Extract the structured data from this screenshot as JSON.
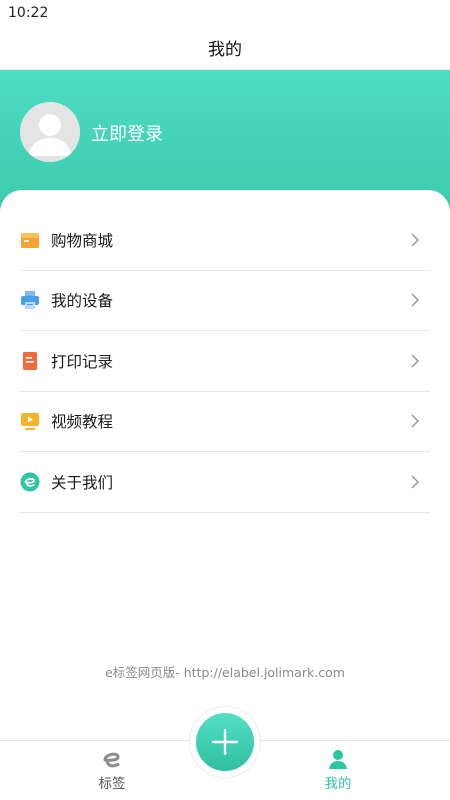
{
  "status_bar": {
    "time": "10:22"
  },
  "title_bar": {
    "title": "我的"
  },
  "profile": {
    "login_label": "立即登录"
  },
  "menu": {
    "items": [
      {
        "label": "购物商城",
        "icon": "shopping-icon",
        "color": "#f7a532"
      },
      {
        "label": "我的设备",
        "icon": "printer-icon",
        "color": "#4a9ee6"
      },
      {
        "label": "打印记录",
        "icon": "document-icon",
        "color": "#f06a3a"
      },
      {
        "label": "视频教程",
        "icon": "video-icon",
        "color": "#f5b52a"
      },
      {
        "label": "关于我们",
        "icon": "e-logo-icon",
        "color": "#2ec5a5"
      }
    ]
  },
  "footer": {
    "website": "e标签网页版- http://elabel.jolimark.com"
  },
  "bottom_nav": {
    "tabs": [
      {
        "label": "标签",
        "icon": "e-label-icon",
        "active": false
      },
      {
        "label": "我的",
        "icon": "person-icon",
        "active": true
      }
    ],
    "center_button": {
      "icon": "plus-icon"
    }
  },
  "colors": {
    "accent": "#2ec5a5",
    "header_top": "#4ddcc4",
    "header_bottom": "#3bc9a9"
  }
}
